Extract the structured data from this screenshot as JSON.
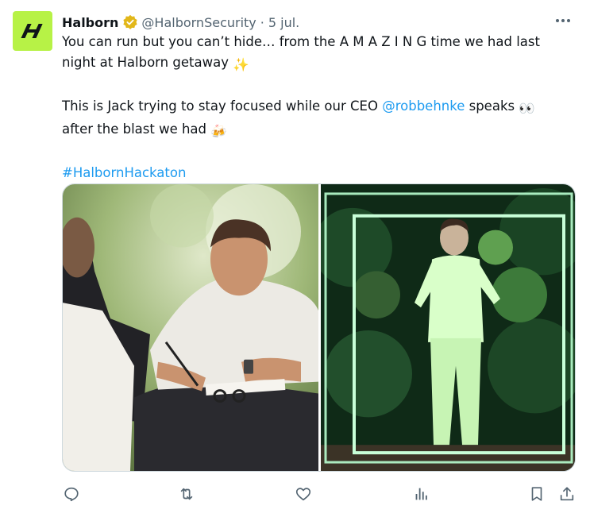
{
  "tweet": {
    "author_name": "Halborn",
    "handle": "@HalbornSecurity",
    "separator": "·",
    "time": "5 jul.",
    "line1_a": "You can run but you can’t hide… from the A M A Z I N G time we had last night at Halborn getaway",
    "line2_a": "This is Jack trying to stay focused while our CEO",
    "mention": "@robbehnke",
    "line2_b": "speaks",
    "line2_c": "after the blast we had",
    "hashtag": "#HalbornHackaton",
    "emoji_sparkles": "✨",
    "emoji_eyes": "👀",
    "emoji_beer": "🍻"
  },
  "icons": {
    "avatar": "halborn-logo",
    "verified": "verified-badge-icon",
    "more": "more-icon",
    "reply": "reply-icon",
    "retweet": "retweet-icon",
    "like": "like-icon",
    "views": "views-icon",
    "bookmark": "bookmark-icon",
    "share": "share-icon"
  },
  "colors": {
    "brand": "#b7f246",
    "link": "#1d9bf0",
    "muted": "#536471",
    "badge": "#e2b719"
  }
}
